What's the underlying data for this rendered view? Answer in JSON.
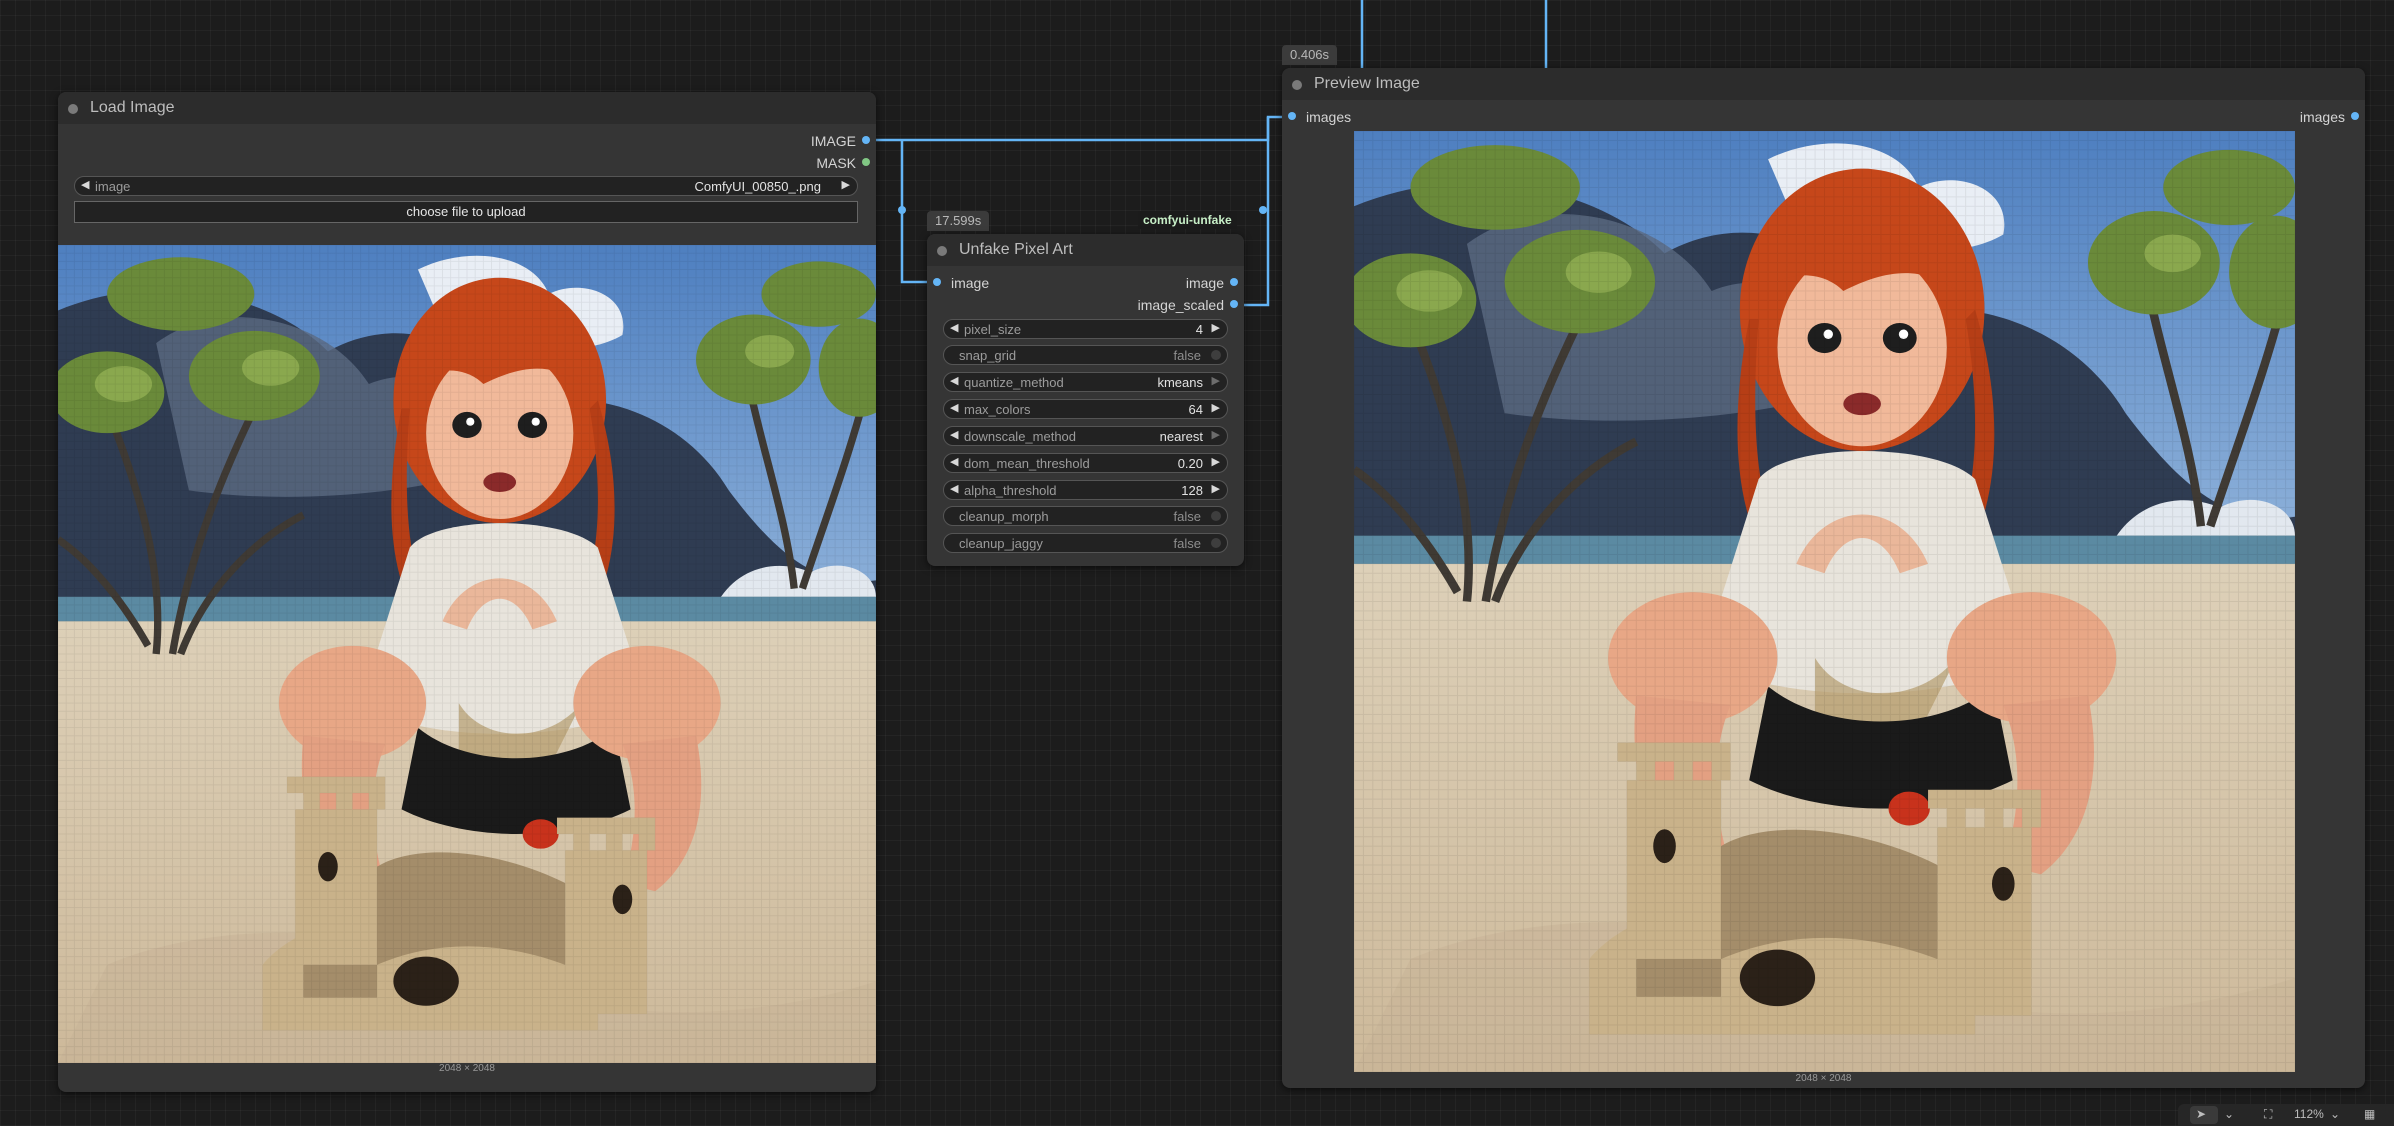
{
  "colors": {
    "canvas": "#1c1c1c",
    "node_body": "#353535",
    "node_header": "#2c2c2c",
    "link_image": "#64b5f6",
    "mask_port": "#81c784",
    "extension_badge_text": "#c8f0c8"
  },
  "load_image_node": {
    "title": "Load Image",
    "outputs": [
      "IMAGE",
      "MASK"
    ],
    "image_widget": {
      "label": "image",
      "value": "ComfyUI_00850_.png"
    },
    "upload_button": "choose file to upload",
    "image_size": "2048 × 2048",
    "image_icon": "pixel-art-girl-sandcastle-image"
  },
  "unfake_node": {
    "title": "Unfake Pixel Art",
    "execution_time": "17.599s",
    "extension_badge": "comfyui-unfake",
    "input": "image",
    "outputs": [
      "image",
      "image_scaled"
    ],
    "widgets": [
      {
        "label": "pixel_size",
        "value": "4",
        "kind": "number"
      },
      {
        "label": "snap_grid",
        "value": "false",
        "kind": "toggle"
      },
      {
        "label": "quantize_method",
        "value": "kmeans",
        "kind": "combo"
      },
      {
        "label": "max_colors",
        "value": "64",
        "kind": "number"
      },
      {
        "label": "downscale_method",
        "value": "nearest",
        "kind": "combo"
      },
      {
        "label": "dom_mean_threshold",
        "value": "0.20",
        "kind": "number"
      },
      {
        "label": "alpha_threshold",
        "value": "128",
        "kind": "number"
      },
      {
        "label": "cleanup_morph",
        "value": "false",
        "kind": "toggle"
      },
      {
        "label": "cleanup_jaggy",
        "value": "false",
        "kind": "toggle"
      }
    ]
  },
  "preview_node": {
    "title": "Preview Image",
    "execution_time": "0.406s",
    "input": "images",
    "output": "images",
    "image_size": "2048 × 2048",
    "image_icon": "pixelated-girl-sandcastle-image"
  },
  "toolbar": {
    "select_icon": "pointer-icon",
    "fit_icon": "fit-view-icon",
    "zoom": "112%",
    "map_icon": "minimap-icon"
  }
}
